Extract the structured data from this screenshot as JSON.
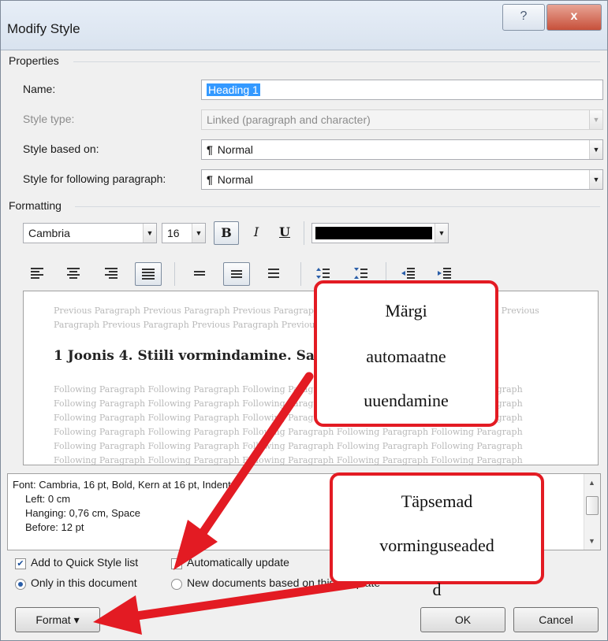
{
  "window": {
    "title": "Modify Style",
    "help_icon": "?",
    "close_icon": "x"
  },
  "properties": {
    "group_label": "Properties",
    "name_label": "Name:",
    "name_value": "Heading 1",
    "style_type_label": "Style type:",
    "style_type_value": "Linked (paragraph and character)",
    "based_on_label": "Style based on:",
    "based_on_value": "Normal",
    "following_label": "Style for following paragraph:",
    "following_value": "Normal",
    "pilcrow": "¶"
  },
  "formatting": {
    "group_label": "Formatting",
    "font": "Cambria",
    "size": "16",
    "bold": "B",
    "italic": "I",
    "underline": "U",
    "font_color": "#000000"
  },
  "preview": {
    "previous_line1": "Previous Paragraph Previous Paragraph Previous Paragraph Previous Paragraph Previous Paragraph Previous",
    "previous_line2": "Paragraph Previous Paragraph Previous Paragraph Previous Paragraph Previous Paragraph",
    "heading": "1   Joonis 4. Stiili vormindamine. Samm 2",
    "following_line": "Following Paragraph Following Paragraph Following Paragraph Following Paragraph Following Paragraph"
  },
  "description": {
    "line1": "Font: Cambria, 16 pt, Bold, Kern at 16 pt, Indent:",
    "line2": "Left:  0 cm",
    "line3": "Hanging:  0,76 cm, Space",
    "line4": "Before:  12 pt"
  },
  "options": {
    "add_quick_style": "Add to Quick Style list",
    "auto_update": "Automatically update",
    "only_this_doc": "Only in this document",
    "new_docs": "New documents based on this template"
  },
  "buttons": {
    "format": "Format ▾",
    "ok": "OK",
    "cancel": "Cancel"
  },
  "callouts": {
    "c1_line1": "Märgi",
    "c1_line2": "automaatne",
    "c1_line3": "uuendamine",
    "c2_line1": "Täpsemad",
    "c2_line2": "vorminguseaded",
    "c2_line3": "d"
  },
  "colors": {
    "accent": "#3399ff",
    "callout": "#e31b23"
  }
}
